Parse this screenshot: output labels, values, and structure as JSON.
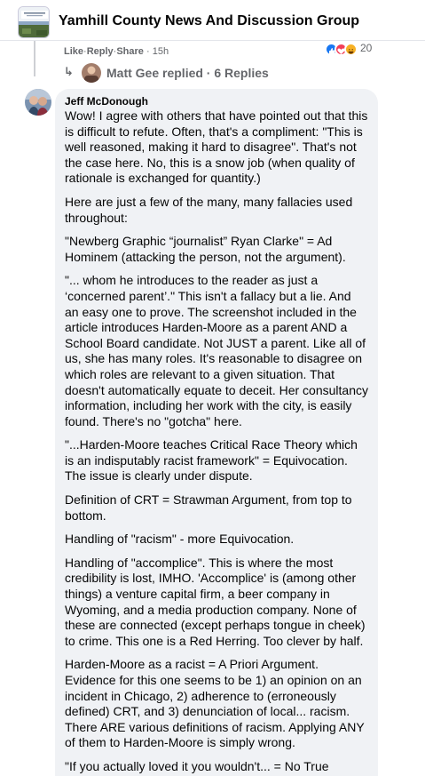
{
  "header": {
    "group_name": "Yamhill County News And Discussion Group"
  },
  "prev_comment": {
    "actions": {
      "like": "Like",
      "reply": "Reply",
      "share": "Share"
    },
    "separator": "·",
    "time": "15h",
    "reaction_count": "20",
    "reaction_icons": [
      "like-icon",
      "love-icon",
      "haha-icon"
    ],
    "reaction_colors": [
      "#1877f2",
      "#f33e58",
      "#f7b125"
    ]
  },
  "replies_link": {
    "user": "Matt Gee",
    "text": "Matt Gee replied · 6 Replies"
  },
  "comment": {
    "author": "Jeff McDonough",
    "paragraphs": [
      "Wow! I agree with others that have pointed out that this is difficult to refute. Often, that's a compliment: \"This is well reasoned, making it hard to disagree\". That's not the case here. No, this is a snow job (when quality of rationale is exchanged for quantity.)",
      "Here are just a few of the many, many fallacies used throughout:",
      "\"Newberg Graphic “journalist” Ryan Clarke\" = Ad Hominem (attacking the person, not the argument).",
      "\"... whom he introduces to the reader as just a ‘concerned parent’.\" This isn't a fallacy but a lie. And an easy one to prove. The screenshot included in the article introduces Harden-Moore as a parent AND a School Board candidate. Not JUST a parent. Like all of us, she has many roles. It's reasonable to disagree on which roles are relevant to a given situation. That doesn't automatically equate to deceit. Her consultancy information, including her work with the city, is easily found. There's no \"gotcha\" here.",
      "\"...Harden-Moore teaches Critical Race Theory which is an indisputably racist framework\" = Equivocation. The issue is clearly under dispute.",
      "Definition of CRT = Strawman Argument, from top to bottom.",
      "Handling of \"racism\" - more Equivocation.",
      "Handling of \"accomplice\". This is where the most credibility is lost, IMHO. 'Accomplice' is (among other things) a venture capital firm, a beer company in Wyoming, and a media production company. None of these are connected (except perhaps tongue in cheek) to crime. This one is a Red Herring. Too clever by half.",
      "Harden-Moore as a racist = A Priori Argument. Evidence for this one seems to be 1) an opinion on an incident in Chicago, 2) adherence to (erroneously defined) CRT, and 3) denunciation of local... racism. There ARE various definitions of racism. Applying ANY of them to Harden-Moore is simply wrong.",
      "\"If you actually loved it you wouldn't... = No True Scotsman Fallacy",
      "***"
    ]
  }
}
